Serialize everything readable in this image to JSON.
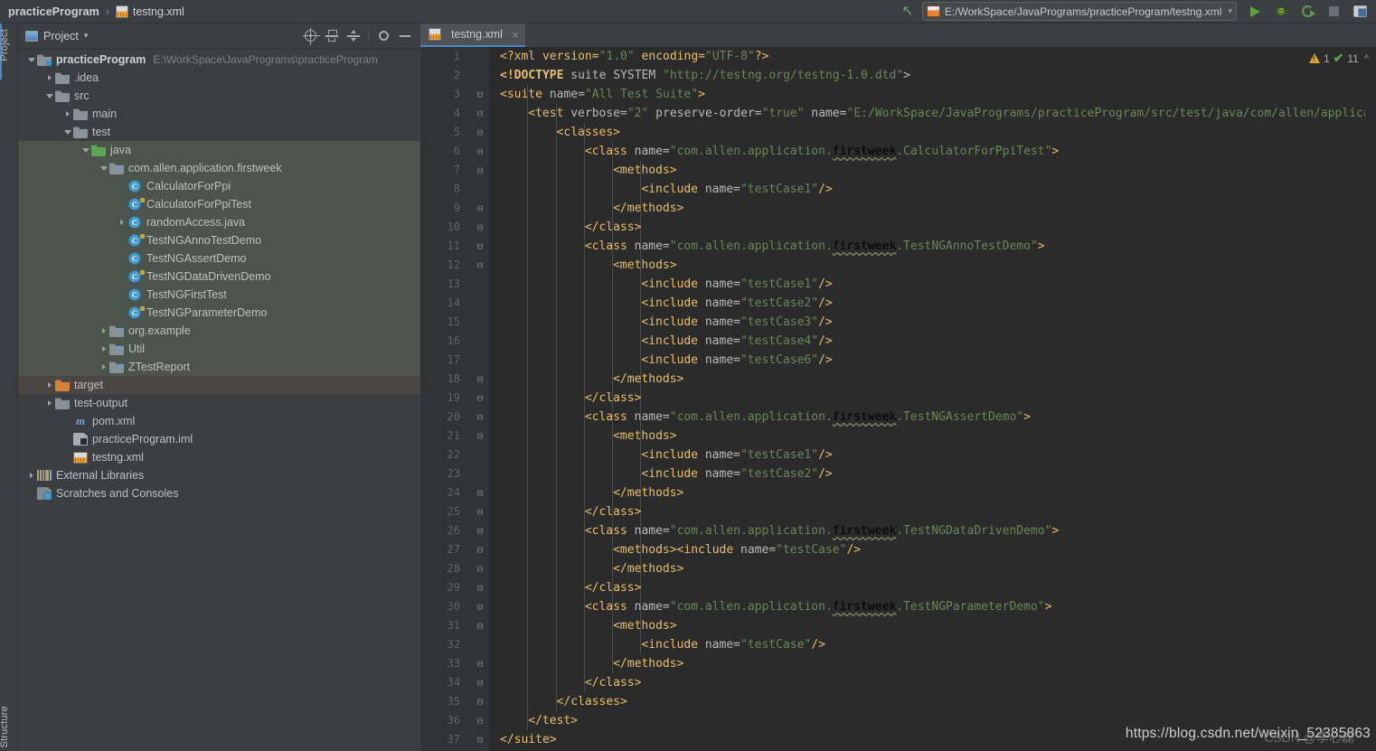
{
  "breadcrumb": {
    "project": "practiceProgram",
    "separator": "›",
    "file": "testng.xml"
  },
  "toolbar": {
    "back_arrow": "back-arrow",
    "run_config": "E:/WorkSpace/JavaPrograms/practiceProgram/testng.xml",
    "run_config_caret": "▾",
    "run_label": "Run",
    "debug_label": "Debug",
    "coverage_label": "Run with Coverage",
    "stop_label": "Stop",
    "layout_label": "Layout Settings"
  },
  "left_rail": {
    "project": "Project",
    "structure": "Structure"
  },
  "project_panel": {
    "title": "Project",
    "caret": "▾",
    "tools": {
      "locate": "Select Opened File",
      "collapse": "Collapse All",
      "expand": "Expand All",
      "settings": "Settings",
      "minimize": "Hide"
    },
    "tree": [
      {
        "label": "practiceProgram",
        "path": "E:\\WorkSpace\\JavaPrograms\\practiceProgram",
        "indent": 0,
        "icon": "module",
        "twisty": "down",
        "bold": true,
        "sel": ""
      },
      {
        "label": ".idea",
        "path": "",
        "indent": 1,
        "icon": "folder",
        "twisty": "right",
        "bold": false,
        "sel": ""
      },
      {
        "label": "src",
        "path": "",
        "indent": 1,
        "icon": "folder",
        "twisty": "down",
        "bold": false,
        "sel": ""
      },
      {
        "label": "main",
        "path": "",
        "indent": 2,
        "icon": "folder",
        "twisty": "right",
        "bold": false,
        "sel": ""
      },
      {
        "label": "test",
        "path": "",
        "indent": 2,
        "icon": "folder",
        "twisty": "down",
        "bold": false,
        "sel": ""
      },
      {
        "label": "java",
        "path": "",
        "indent": 3,
        "icon": "folder-green",
        "twisty": "down",
        "bold": false,
        "sel": "green"
      },
      {
        "label": "com.allen.application.firstweek",
        "path": "",
        "indent": 4,
        "icon": "package",
        "twisty": "down",
        "bold": false,
        "sel": "green"
      },
      {
        "label": "CalculatorForPpi",
        "path": "",
        "indent": 5,
        "icon": "class",
        "twisty": "",
        "bold": false,
        "sel": "green"
      },
      {
        "label": "CalculatorForPpiTest",
        "path": "",
        "indent": 5,
        "icon": "class-test",
        "twisty": "",
        "bold": false,
        "sel": "green"
      },
      {
        "label": "randomAccess.java",
        "path": "",
        "indent": 5,
        "icon": "class",
        "twisty": "right",
        "bold": false,
        "sel": "green"
      },
      {
        "label": "TestNGAnnoTestDemo",
        "path": "",
        "indent": 5,
        "icon": "class-test",
        "twisty": "",
        "bold": false,
        "sel": "green"
      },
      {
        "label": "TestNGAssertDemo",
        "path": "",
        "indent": 5,
        "icon": "class",
        "twisty": "",
        "bold": false,
        "sel": "green"
      },
      {
        "label": "TestNGDataDrivenDemo",
        "path": "",
        "indent": 5,
        "icon": "class-test",
        "twisty": "",
        "bold": false,
        "sel": "green"
      },
      {
        "label": "TestNGFirstTest",
        "path": "",
        "indent": 5,
        "icon": "class",
        "twisty": "",
        "bold": false,
        "sel": "green"
      },
      {
        "label": "TestNGParameterDemo",
        "path": "",
        "indent": 5,
        "icon": "class-test",
        "twisty": "",
        "bold": false,
        "sel": "green"
      },
      {
        "label": "org.example",
        "path": "",
        "indent": 4,
        "icon": "package",
        "twisty": "right",
        "bold": false,
        "sel": "green"
      },
      {
        "label": "Util",
        "path": "",
        "indent": 4,
        "icon": "package",
        "twisty": "right",
        "bold": false,
        "sel": "green"
      },
      {
        "label": "ZTestReport",
        "path": "",
        "indent": 4,
        "icon": "package",
        "twisty": "right",
        "bold": false,
        "sel": "green"
      },
      {
        "label": "target",
        "path": "",
        "indent": 1,
        "icon": "folder-orange",
        "twisty": "right",
        "bold": false,
        "sel": "brown"
      },
      {
        "label": "test-output",
        "path": "",
        "indent": 1,
        "icon": "folder",
        "twisty": "right",
        "bold": false,
        "sel": ""
      },
      {
        "label": "pom.xml",
        "path": "",
        "indent": 2,
        "icon": "maven",
        "twisty": "",
        "bold": false,
        "sel": ""
      },
      {
        "label": "practiceProgram.iml",
        "path": "",
        "indent": 2,
        "icon": "iml",
        "twisty": "",
        "bold": false,
        "sel": ""
      },
      {
        "label": "testng.xml",
        "path": "",
        "indent": 2,
        "icon": "xml",
        "twisty": "",
        "bold": false,
        "sel": ""
      },
      {
        "label": "External Libraries",
        "path": "",
        "indent": 0,
        "icon": "lib",
        "twisty": "right",
        "bold": false,
        "sel": ""
      },
      {
        "label": "Scratches and Consoles",
        "path": "",
        "indent": 0,
        "icon": "scratch",
        "twisty": "",
        "bold": false,
        "sel": ""
      }
    ]
  },
  "editor": {
    "tab": {
      "label": "testng.xml",
      "close": "×"
    },
    "inspection": {
      "warning_count": "1",
      "ok_count": "11",
      "caret": "^"
    },
    "lines": [
      {
        "n": "1",
        "fold": "",
        "indent": 0,
        "segs": [
          {
            "t": "<?xml version=",
            "c": "pi"
          },
          {
            "t": "\"1.0\"",
            "c": "str"
          },
          {
            "t": " encoding=",
            "c": "pi"
          },
          {
            "t": "\"UTF-8\"",
            "c": "str"
          },
          {
            "t": "?>",
            "c": "pi"
          }
        ]
      },
      {
        "n": "2",
        "fold": "",
        "indent": 0,
        "segs": [
          {
            "t": "<!DOCTYPE",
            "c": "doct"
          },
          {
            "t": " suite SYSTEM ",
            "c": "attr"
          },
          {
            "t": "\"http://testng.org/testng-1.0.dtd\"",
            "c": "str"
          },
          {
            "t": ">",
            "c": "attr"
          }
        ]
      },
      {
        "n": "3",
        "fold": "⊟",
        "indent": 0,
        "segs": [
          {
            "t": "<suite",
            "c": "tag"
          },
          {
            "t": " name=",
            "c": "attr"
          },
          {
            "t": "\"All Test Suite\"",
            "c": "str"
          },
          {
            "t": ">",
            "c": "tag"
          }
        ]
      },
      {
        "n": "4",
        "fold": "⊟",
        "indent": 1,
        "segs": [
          {
            "t": "<test",
            "c": "tag"
          },
          {
            "t": " verbose=",
            "c": "attr"
          },
          {
            "t": "\"2\"",
            "c": "str"
          },
          {
            "t": " preserve-order=",
            "c": "attr"
          },
          {
            "t": "\"true\"",
            "c": "str"
          },
          {
            "t": " name=",
            "c": "attr"
          },
          {
            "t": "\"E:/WorkSpace/JavaPrograms/practiceProgram/src/test/java/com/allen/applicat",
            "c": "str"
          }
        ]
      },
      {
        "n": "5",
        "fold": "⊟",
        "indent": 2,
        "segs": [
          {
            "t": "<classes>",
            "c": "tag"
          }
        ]
      },
      {
        "n": "6",
        "fold": "⊟",
        "indent": 3,
        "segs": [
          {
            "t": "<class",
            "c": "tag"
          },
          {
            "t": " name=",
            "c": "attr"
          },
          {
            "t": "\"com.allen.application.",
            "c": "str"
          },
          {
            "t": "firstweek",
            "c": "squig"
          },
          {
            "t": ".CalculatorForPpiTest\"",
            "c": "str"
          },
          {
            "t": ">",
            "c": "tag"
          }
        ]
      },
      {
        "n": "7",
        "fold": "⊟",
        "indent": 4,
        "segs": [
          {
            "t": "<methods>",
            "c": "tag"
          }
        ]
      },
      {
        "n": "8",
        "fold": "",
        "indent": 5,
        "segs": [
          {
            "t": "<include",
            "c": "tag"
          },
          {
            "t": " name=",
            "c": "attr"
          },
          {
            "t": "\"testCase1\"",
            "c": "str"
          },
          {
            "t": "/>",
            "c": "tag"
          }
        ]
      },
      {
        "n": "9",
        "fold": "⊟",
        "indent": 4,
        "segs": [
          {
            "t": "</methods>",
            "c": "tag"
          }
        ]
      },
      {
        "n": "10",
        "fold": "⊟",
        "indent": 3,
        "segs": [
          {
            "t": "</class>",
            "c": "tag"
          }
        ]
      },
      {
        "n": "11",
        "fold": "⊟",
        "indent": 3,
        "segs": [
          {
            "t": "<class",
            "c": "tag"
          },
          {
            "t": " name=",
            "c": "attr"
          },
          {
            "t": "\"com.allen.application.",
            "c": "str"
          },
          {
            "t": "firstweek",
            "c": "squig"
          },
          {
            "t": ".TestNGAnnoTestDemo\"",
            "c": "str"
          },
          {
            "t": ">",
            "c": "tag"
          }
        ]
      },
      {
        "n": "12",
        "fold": "⊟",
        "indent": 4,
        "segs": [
          {
            "t": "<methods>",
            "c": "tag"
          }
        ]
      },
      {
        "n": "13",
        "fold": "",
        "indent": 5,
        "segs": [
          {
            "t": "<include",
            "c": "tag"
          },
          {
            "t": " name=",
            "c": "attr"
          },
          {
            "t": "\"testCase1\"",
            "c": "str"
          },
          {
            "t": "/>",
            "c": "tag"
          }
        ]
      },
      {
        "n": "14",
        "fold": "",
        "indent": 5,
        "segs": [
          {
            "t": "<include",
            "c": "tag"
          },
          {
            "t": " name=",
            "c": "attr"
          },
          {
            "t": "\"testCase2\"",
            "c": "str"
          },
          {
            "t": "/>",
            "c": "tag"
          }
        ]
      },
      {
        "n": "15",
        "fold": "",
        "indent": 5,
        "segs": [
          {
            "t": "<include",
            "c": "tag"
          },
          {
            "t": " name=",
            "c": "attr"
          },
          {
            "t": "\"testCase3\"",
            "c": "str"
          },
          {
            "t": "/>",
            "c": "tag"
          }
        ]
      },
      {
        "n": "16",
        "fold": "",
        "indent": 5,
        "segs": [
          {
            "t": "<include",
            "c": "tag"
          },
          {
            "t": " name=",
            "c": "attr"
          },
          {
            "t": "\"testCase4\"",
            "c": "str"
          },
          {
            "t": "/>",
            "c": "tag"
          }
        ]
      },
      {
        "n": "17",
        "fold": "",
        "indent": 5,
        "segs": [
          {
            "t": "<include",
            "c": "tag"
          },
          {
            "t": " name=",
            "c": "attr"
          },
          {
            "t": "\"testCase6\"",
            "c": "str"
          },
          {
            "t": "/>",
            "c": "tag"
          }
        ]
      },
      {
        "n": "18",
        "fold": "⊟",
        "indent": 4,
        "segs": [
          {
            "t": "</methods>",
            "c": "tag"
          }
        ]
      },
      {
        "n": "19",
        "fold": "⊟",
        "indent": 3,
        "segs": [
          {
            "t": "</class>",
            "c": "tag"
          }
        ]
      },
      {
        "n": "20",
        "fold": "⊟",
        "indent": 3,
        "segs": [
          {
            "t": "<class",
            "c": "tag"
          },
          {
            "t": " name=",
            "c": "attr"
          },
          {
            "t": "\"com.allen.application.",
            "c": "str"
          },
          {
            "t": "firstweek",
            "c": "squig"
          },
          {
            "t": ".TestNGAssertDemo\"",
            "c": "str"
          },
          {
            "t": ">",
            "c": "tag"
          }
        ]
      },
      {
        "n": "21",
        "fold": "⊟",
        "indent": 4,
        "segs": [
          {
            "t": "<methods>",
            "c": "tag"
          }
        ]
      },
      {
        "n": "22",
        "fold": "",
        "indent": 5,
        "segs": [
          {
            "t": "<include",
            "c": "tag"
          },
          {
            "t": " name=",
            "c": "attr"
          },
          {
            "t": "\"testCase1\"",
            "c": "str"
          },
          {
            "t": "/>",
            "c": "tag"
          }
        ]
      },
      {
        "n": "23",
        "fold": "",
        "indent": 5,
        "segs": [
          {
            "t": "<include",
            "c": "tag"
          },
          {
            "t": " name=",
            "c": "attr"
          },
          {
            "t": "\"testCase2\"",
            "c": "str"
          },
          {
            "t": "/>",
            "c": "tag"
          }
        ]
      },
      {
        "n": "24",
        "fold": "⊟",
        "indent": 4,
        "segs": [
          {
            "t": "</methods>",
            "c": "tag"
          }
        ]
      },
      {
        "n": "25",
        "fold": "⊟",
        "indent": 3,
        "segs": [
          {
            "t": "</class>",
            "c": "tag"
          }
        ]
      },
      {
        "n": "26",
        "fold": "⊟",
        "indent": 3,
        "segs": [
          {
            "t": "<class",
            "c": "tag"
          },
          {
            "t": " name=",
            "c": "attr"
          },
          {
            "t": "\"com.allen.application.",
            "c": "str"
          },
          {
            "t": "firstweek",
            "c": "squig"
          },
          {
            "t": ".TestNGDataDrivenDemo\"",
            "c": "str"
          },
          {
            "t": ">",
            "c": "tag"
          }
        ]
      },
      {
        "n": "27",
        "fold": "⊟",
        "indent": 4,
        "segs": [
          {
            "t": "<methods>",
            "c": "tag"
          },
          {
            "t": "<include",
            "c": "tag"
          },
          {
            "t": " name=",
            "c": "attr"
          },
          {
            "t": "\"testCase\"",
            "c": "str"
          },
          {
            "t": "/>",
            "c": "tag"
          }
        ]
      },
      {
        "n": "28",
        "fold": "⊟",
        "indent": 4,
        "segs": [
          {
            "t": "</methods>",
            "c": "tag"
          }
        ]
      },
      {
        "n": "29",
        "fold": "⊟",
        "indent": 3,
        "segs": [
          {
            "t": "</class>",
            "c": "tag"
          }
        ]
      },
      {
        "n": "30",
        "fold": "⊟",
        "indent": 3,
        "segs": [
          {
            "t": "<class",
            "c": "tag"
          },
          {
            "t": " name=",
            "c": "attr"
          },
          {
            "t": "\"com.allen.application.",
            "c": "str"
          },
          {
            "t": "firstweek",
            "c": "squig"
          },
          {
            "t": ".TestNGParameterDemo\"",
            "c": "str"
          },
          {
            "t": ">",
            "c": "tag"
          }
        ]
      },
      {
        "n": "31",
        "fold": "⊟",
        "indent": 4,
        "segs": [
          {
            "t": "<methods>",
            "c": "tag"
          }
        ]
      },
      {
        "n": "32",
        "fold": "",
        "indent": 5,
        "segs": [
          {
            "t": "<include",
            "c": "tag"
          },
          {
            "t": " name=",
            "c": "attr"
          },
          {
            "t": "\"testCase\"",
            "c": "str"
          },
          {
            "t": "/>",
            "c": "tag"
          }
        ]
      },
      {
        "n": "33",
        "fold": "⊟",
        "indent": 4,
        "segs": [
          {
            "t": "</methods>",
            "c": "tag"
          }
        ]
      },
      {
        "n": "34",
        "fold": "⊟",
        "indent": 3,
        "segs": [
          {
            "t": "</class>",
            "c": "tag"
          }
        ]
      },
      {
        "n": "35",
        "fold": "⊟",
        "indent": 2,
        "segs": [
          {
            "t": "</classes>",
            "c": "tag"
          }
        ]
      },
      {
        "n": "36",
        "fold": "⊟",
        "indent": 1,
        "segs": [
          {
            "t": "</test>",
            "c": "tag"
          }
        ]
      },
      {
        "n": "37",
        "fold": "⊟",
        "indent": 0,
        "segs": [
          {
            "t": "</suite>",
            "c": "tag"
          }
        ]
      }
    ]
  },
  "watermark": {
    "url": "https://blog.csdn.net/weixin_52385863",
    "overlay": "CSDN @李心磊"
  },
  "colors": {
    "panel_bg": "#3C3F41",
    "editor_bg": "#2B2B2B",
    "gutter_bg": "#313335",
    "select_green": "#4C554C",
    "select_brown": "#4B4642",
    "accent_blue": "#4A88C7",
    "tag": "#E8BF6A",
    "string": "#6A8759",
    "attr": "#BABABA"
  }
}
